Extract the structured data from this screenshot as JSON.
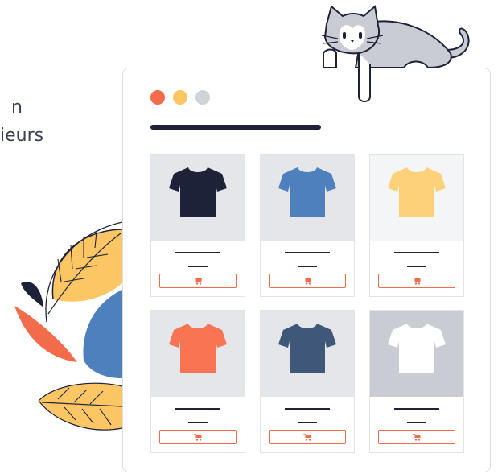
{
  "page": {
    "text_line_1": "n",
    "text_line_2": "ieurs"
  },
  "colors": {
    "accent": "#f26b4b",
    "navy": "#1e2238",
    "dot_red": "#f26b4b",
    "dot_yellow": "#fbc663",
    "dot_gray": "#cfd3da"
  },
  "products": [
    {
      "shirt_color": "#1e2238",
      "bg": "#e4e6ea",
      "icon": "cart-icon"
    },
    {
      "shirt_color": "#4d80bd",
      "bg": "#e4e6ea",
      "icon": "cart-icon"
    },
    {
      "shirt_color": "#fdd07a",
      "bg": "#f4f5f6",
      "icon": "cart-icon"
    },
    {
      "shirt_color": "#f87453",
      "bg": "#e4e6ea",
      "icon": "cart-icon"
    },
    {
      "shirt_color": "#3f5778",
      "bg": "#e4e6ea",
      "icon": "cart-icon"
    },
    {
      "shirt_color": "#ffffff",
      "bg": "#c9ccd3",
      "icon": "cart-icon"
    }
  ]
}
